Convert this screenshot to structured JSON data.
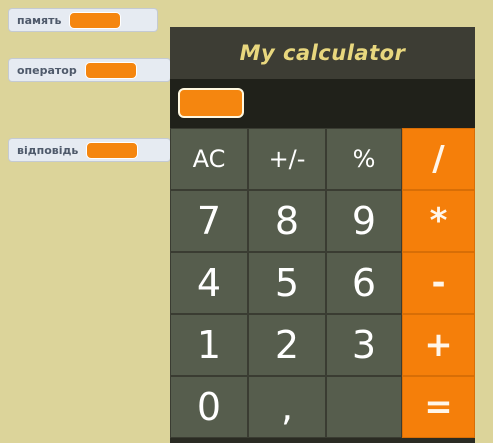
{
  "monitors": {
    "memory_label": "память",
    "operator_label": "оператор",
    "answer_label": "відповідь"
  },
  "calculator": {
    "title": "My calculator",
    "display_value": "",
    "keys": {
      "ac": "AC",
      "plusminus": "+/-",
      "percent": "%",
      "divide": "/",
      "seven": "7",
      "eight": "8",
      "nine": "9",
      "multiply": "*",
      "four": "4",
      "five": "5",
      "six": "6",
      "minus": "-",
      "one": "1",
      "two": "2",
      "three": "3",
      "plus": "+",
      "zero": "0",
      "comma": ",",
      "blank": "",
      "equals": "="
    }
  },
  "colors": {
    "stage_bg": "#dcd49a",
    "accent_orange": "#f5860f",
    "key_grey": "#565d4d",
    "title_yellow": "#e8d77e"
  }
}
